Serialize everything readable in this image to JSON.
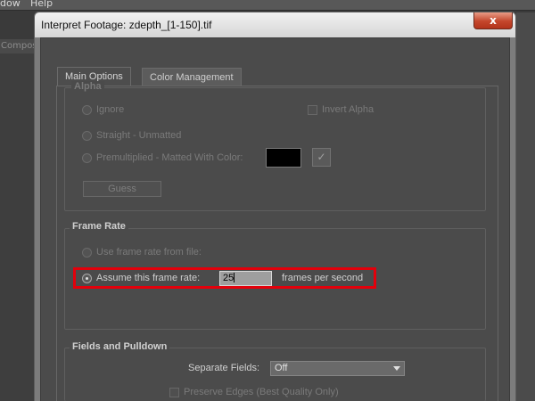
{
  "menubar": {
    "item1": "dow",
    "item2": "Help"
  },
  "panel_tab": "Composit",
  "dialog": {
    "title": "Interpret Footage: zdepth_[1-150].tif",
    "close_glyph": "x",
    "tabs": [
      "Main Options",
      "Color Management"
    ],
    "alpha": {
      "label": "Alpha",
      "ignore": "Ignore",
      "invert": "Invert Alpha",
      "straight": "Straight - Unmatted",
      "premultiplied": "Premultiplied - Matted With Color:",
      "matte_color": "#000000",
      "guess": "Guess"
    },
    "frame_rate": {
      "label": "Frame Rate",
      "from_file": "Use frame rate from file:",
      "assume": "Assume this frame rate:",
      "value": "25",
      "unit": "frames per second"
    },
    "fields": {
      "label": "Fields and Pulldown",
      "separate_label": "Separate Fields:",
      "separate_value": "Off",
      "preserve_edges": "Preserve Edges (Best Quality Only)"
    }
  },
  "colors": {
    "highlight": "#e3000b",
    "close_button": "#c4462b"
  }
}
